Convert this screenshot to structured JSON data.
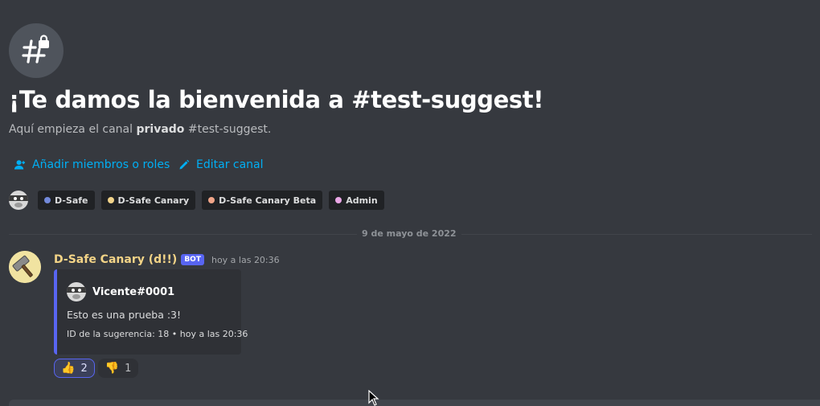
{
  "channel": {
    "icon": "locked-hashtag-icon",
    "welcome_title": "¡Te damos la bienvenida a #test-suggest!",
    "subtitle_prefix": "Aquí empieza el canal ",
    "subtitle_bold": "privado",
    "subtitle_suffix": " #test-suggest."
  },
  "actions": {
    "add_members_icon": "user-add-icon",
    "add_members_label": "Añadir miembros o roles",
    "edit_channel_icon": "pencil-icon",
    "edit_channel_label": "Editar canal"
  },
  "roles": [
    {
      "name": "D-Safe",
      "color": "#7289da"
    },
    {
      "name": "D-Safe Canary",
      "color": "#f1d38a"
    },
    {
      "name": "D-Safe Canary Beta",
      "color": "#f0a589"
    },
    {
      "name": "Admin",
      "color": "#eaa7e6"
    }
  ],
  "date_divider": "9 de mayo de 2022",
  "message": {
    "username": "D-Safe Canary (d!!)",
    "bot_tag": "BOT",
    "timestamp": "hoy a las 20:36",
    "embed": {
      "author": "Vicente#0001",
      "description": "Esto es una prueba :3!",
      "footer": "ID de la sugerencia: 18 • hoy a las 20:36",
      "accent_color": "#5865f2"
    },
    "reactions": [
      {
        "emoji": "👍",
        "icon": "thumbs-up-icon",
        "count": "2"
      },
      {
        "emoji": "👎",
        "icon": "thumbs-down-icon",
        "count": "1"
      }
    ]
  },
  "colors": {
    "background": "#36393f",
    "link": "#00aff4",
    "username": "#f3d487",
    "bot_tag": "#5865f2"
  }
}
